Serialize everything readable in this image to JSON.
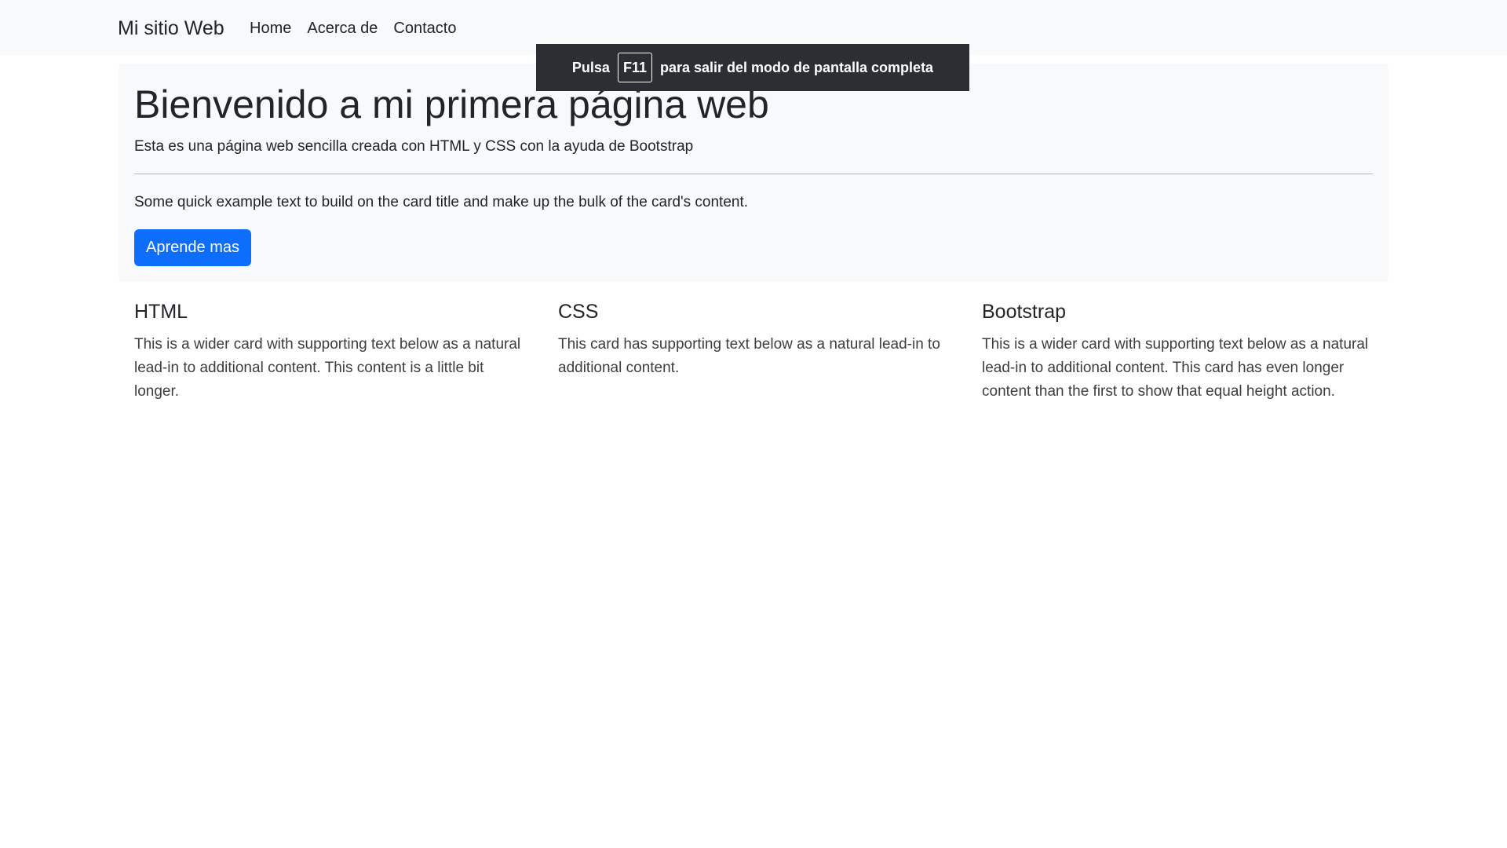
{
  "navbar": {
    "brand": "Mi sitio Web",
    "links": [
      "Home",
      "Acerca de",
      "Contacto"
    ]
  },
  "fullscreen_notice": {
    "prefix": "Pulsa",
    "key": "F11",
    "suffix": "para salir del modo de pantalla completa"
  },
  "jumbotron": {
    "title": "Bienvenido a mi primera página web",
    "lead": "Esta es una página web sencilla creada con HTML y CSS con la ayuda de Bootstrap",
    "text": "Some quick example text to build on the card title and make up the bulk of the card's content.",
    "button_label": "Aprende mas"
  },
  "cards": [
    {
      "title": "HTML",
      "text": "This is a wider card with supporting text below as a natural lead-in to additional content. This content is a little bit longer."
    },
    {
      "title": "CSS",
      "text": "This card has supporting text below as a natural lead-in to additional content."
    },
    {
      "title": "Bootstrap",
      "text": "This is a wider card with supporting text below as a natural lead-in to additional content. This card has even longer content than the first to show that equal height action."
    }
  ],
  "colors": {
    "navbar_bg": "#f8f9fa",
    "primary": "#0d6efd",
    "toast_bg": "#2b2e33"
  }
}
